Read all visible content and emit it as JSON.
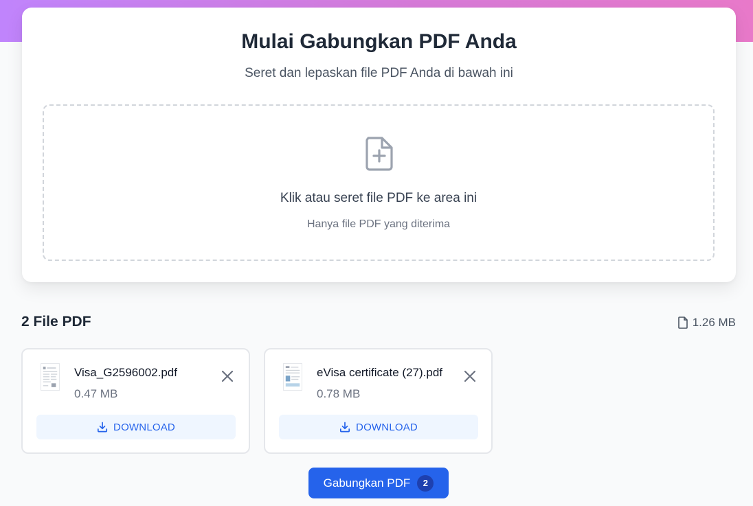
{
  "upload": {
    "title": "Mulai Gabungkan PDF Anda",
    "subtitle": "Seret dan lepaskan file PDF Anda di bawah ini",
    "dropzone_main": "Klik atau seret file PDF ke area ini",
    "dropzone_hint": "Hanya file PDF yang diterima",
    "icon": "file-plus-icon"
  },
  "files": {
    "heading": "2 File PDF",
    "total_size": "1.26 MB",
    "items": [
      {
        "name": "Visa_G2596002.pdf",
        "size": "0.47 MB",
        "download_label": "DOWNLOAD"
      },
      {
        "name": "eVisa certificate (27).pdf",
        "size": "0.78 MB",
        "download_label": "DOWNLOAD"
      }
    ]
  },
  "merge": {
    "label": "Gabungkan PDF",
    "count": "2"
  },
  "colors": {
    "accent": "#2563eb",
    "accent_light": "#eff6ff",
    "gradient_start": "#c084fc",
    "gradient_end": "#e879c9"
  }
}
